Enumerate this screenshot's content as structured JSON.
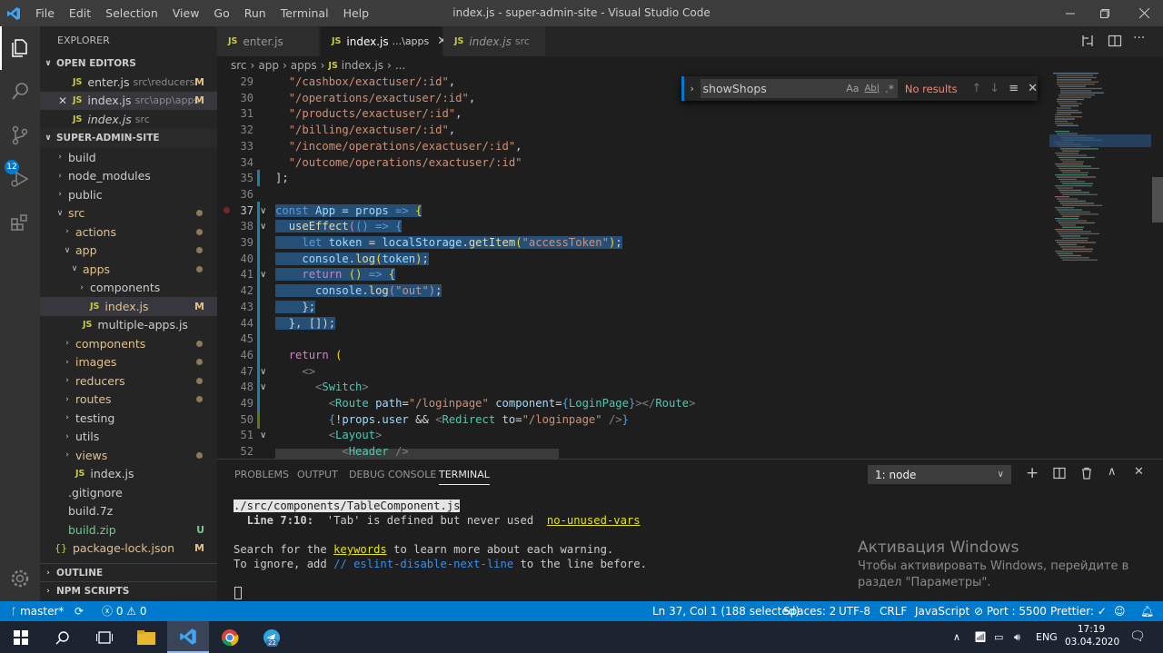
{
  "menu": [
    "File",
    "Edit",
    "Selection",
    "View",
    "Go",
    "Run",
    "Terminal",
    "Help"
  ],
  "window_title": "index.js - super-admin-site - Visual Studio Code",
  "activity_badge": "12",
  "explorer": {
    "title": "EXPLORER",
    "open_editors_label": "OPEN EDITORS",
    "open_editors": [
      {
        "name": "enter.js",
        "desc": "src\\reducers",
        "status": "M"
      },
      {
        "name": "index.js",
        "desc": "src\\app\\apps",
        "status": "M"
      },
      {
        "name": "index.js",
        "desc": "src",
        "status": ""
      }
    ],
    "project_label": "SUPER-ADMIN-SITE",
    "tree": [
      {
        "name": "build",
        "type": "folder",
        "status": ""
      },
      {
        "name": "node_modules",
        "type": "folder",
        "status": ""
      },
      {
        "name": "public",
        "type": "folder",
        "status": ""
      },
      {
        "name": "src",
        "type": "folder-open",
        "status": "dot"
      },
      {
        "name": "actions",
        "type": "folder",
        "status": "dot"
      },
      {
        "name": "app",
        "type": "folder-open",
        "status": "dot"
      },
      {
        "name": "apps",
        "type": "folder-open",
        "status": "dot"
      },
      {
        "name": "components",
        "type": "folder",
        "status": ""
      },
      {
        "name": "index.js",
        "type": "js",
        "status": "M"
      },
      {
        "name": "multiple-apps.js",
        "type": "js",
        "status": ""
      },
      {
        "name": "components",
        "type": "folder",
        "status": "dot"
      },
      {
        "name": "images",
        "type": "folder",
        "status": "dot"
      },
      {
        "name": "reducers",
        "type": "folder",
        "status": "dot"
      },
      {
        "name": "routes",
        "type": "folder",
        "status": "dot"
      },
      {
        "name": "testing",
        "type": "folder",
        "status": ""
      },
      {
        "name": "utils",
        "type": "folder",
        "status": ""
      },
      {
        "name": "views",
        "type": "folder",
        "status": "dot"
      },
      {
        "name": "index.js",
        "type": "js",
        "status": ""
      },
      {
        "name": ".gitignore",
        "type": "file",
        "status": ""
      },
      {
        "name": "build.7z",
        "type": "file",
        "status": ""
      },
      {
        "name": "build.zip",
        "type": "file",
        "status": "U"
      },
      {
        "name": "package-lock.json",
        "type": "json",
        "status": "M"
      }
    ],
    "outline_label": "OUTLINE",
    "npm_label": "NPM SCRIPTS"
  },
  "tabs": [
    {
      "name": "enter.js",
      "desc": ""
    },
    {
      "name": "index.js",
      "desc": "...\\apps"
    },
    {
      "name": "index.js",
      "desc": "src"
    }
  ],
  "breadcrumb": [
    "src",
    "app",
    "apps",
    "index.js",
    "..."
  ],
  "find": {
    "query": "showShops",
    "result": "No results",
    "aa": "Aa",
    "ab": "Ab|",
    "re": ".*"
  },
  "line_numbers": [
    "29",
    "30",
    "31",
    "32",
    "33",
    "34",
    "35",
    "36",
    "37",
    "38",
    "39",
    "40",
    "41",
    "42",
    "43",
    "44",
    "45",
    "46",
    "47",
    "48",
    "49",
    "50",
    "51",
    "52"
  ],
  "code": {
    "l29": "\"/cashbox/exactuser/:id\"",
    "l30": "\"/operations/exactuser/:id\"",
    "l31": "\"/products/exactuser/:id\"",
    "l32": "\"/billing/exactuser/:id\"",
    "l33": "\"/income/operations/exactuser/:id\"",
    "l34": "\"/outcome/operations/exactuser/:id\"",
    "l35": "];",
    "l37a": "const",
    "l37b": "App",
    "l37c": "props",
    "l38": "useEffect",
    "l39a": "let",
    "l39b": "token",
    "l39c": "localStorage",
    "l39d": "getItem",
    "l39e": "\"accessToken\"",
    "l40a": "console",
    "l40b": "log",
    "l40c": "token",
    "l41": "return",
    "l42a": "console",
    "l42b": "log",
    "l42c": "\"out\"",
    "l43": "};",
    "l44": "}, []);",
    "l46": "return",
    "l47": "<>",
    "l48": "Switch",
    "l49a": "Route",
    "l49b": "path",
    "l49c": "\"/loginpage\"",
    "l49d": "component",
    "l49e": "LoginPage",
    "l50a": "props",
    "l50b": "user",
    "l50c": "Redirect",
    "l50d": "to",
    "l50e": "\"/loginpage\"",
    "l51": "Layout",
    "l52": "Header"
  },
  "panel": {
    "tabs": [
      "PROBLEMS",
      "OUTPUT",
      "DEBUG CONSOLE",
      "TERMINAL"
    ],
    "terminal_select": "1: node",
    "lines": {
      "file": "./src/components/TableComponent.js",
      "warn_prefix": "  Line 7:10:  ",
      "warn_msg": "'Tab' is defined but never used  ",
      "warn_rule": "no-unused-vars",
      "search_a": "Search for the ",
      "search_kw": "keywords",
      "search_b": " to learn more about each warning.",
      "ignore_a": "To ignore, add ",
      "ignore_kw": "// eslint-disable-next-line",
      "ignore_b": " to the line before."
    },
    "watermark_title": "Активация Windows",
    "watermark_l1": "Чтобы активировать Windows, перейдите в",
    "watermark_l2": "раздел \"Параметры\"."
  },
  "status": {
    "branch": "master*",
    "errors": "0",
    "warnings": "0",
    "position": "Ln 37, Col 1 (188 selected)",
    "spaces": "Spaces: 2",
    "encoding": "UTF-8",
    "eol": "CRLF",
    "language": "JavaScript",
    "port": "Port : 5500",
    "prettier": "Prettier: ✓"
  },
  "taskbar": {
    "lang": "ENG",
    "time": "17:19",
    "date": "03.04.2020",
    "telegram_badge": "22"
  },
  "colors": {
    "accent": "#007acc",
    "selection": "#264f78"
  }
}
